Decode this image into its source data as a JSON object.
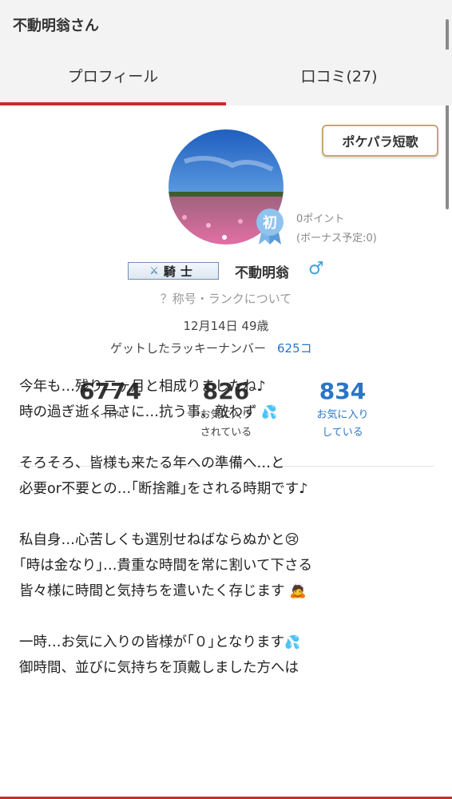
{
  "header": {
    "title": "不動明翁さん"
  },
  "tabs": [
    {
      "label": "プロフィール",
      "active": true
    },
    {
      "label": "口コミ(27)",
      "active": false
    }
  ],
  "profile": {
    "tanka_button": "ポケパラ短歌",
    "first_badge": "初",
    "points": "0ポイント",
    "bonus": "(ボーナス予定:0)",
    "rank_title": "騎士",
    "username": "不動明翁",
    "gender_symbol": "♂",
    "rank_link": "？称号・ランクについて",
    "birthday_age": "12月14日 49歳",
    "lucky_label": "ゲットしたラッキーナンバー",
    "lucky_count": "625コ"
  },
  "stats": [
    {
      "value": "6774",
      "label_line1": "イイネ！",
      "label_line2": ""
    },
    {
      "value": "826",
      "label_line1": "お気に入り",
      "label_line2": "されている"
    },
    {
      "value": "834",
      "label_line1": "お気に入り",
      "label_line2": "している"
    }
  ],
  "post": {
    "lines": [
      "今年も…残り二ヶ月と相成りましたね♪",
      "時の過ぎ逝く早さに…抗う事、敵わず",
      "",
      "そろそろ、皆様も来たる年への準備へ…と",
      "必要or不要との…｢断捨離｣をされる時期です♪",
      "",
      "私自身…心苦しくも選別せねばならぬかと",
      "｢時は金なり｣…貴重な時間を常に割いて下さる",
      "皆々様に時間と気持ちを遣いたく存じます",
      "",
      "一時…お気に入りの皆様が｢０｣となります",
      "御時間、並びに気持ちを頂戴しました方へは"
    ]
  },
  "colors": {
    "accent_red": "#cc2b2b",
    "link_blue": "#2a76c6",
    "gender_blue": "#3ea3d9",
    "tanka_border": "#c8a872"
  },
  "icons": [
    "crossed-swords-icon",
    "first-timer-ribbon-icon",
    "male-icon",
    "sweat-drops-icon",
    "crying-face-icon",
    "bowing-person-icon"
  ]
}
